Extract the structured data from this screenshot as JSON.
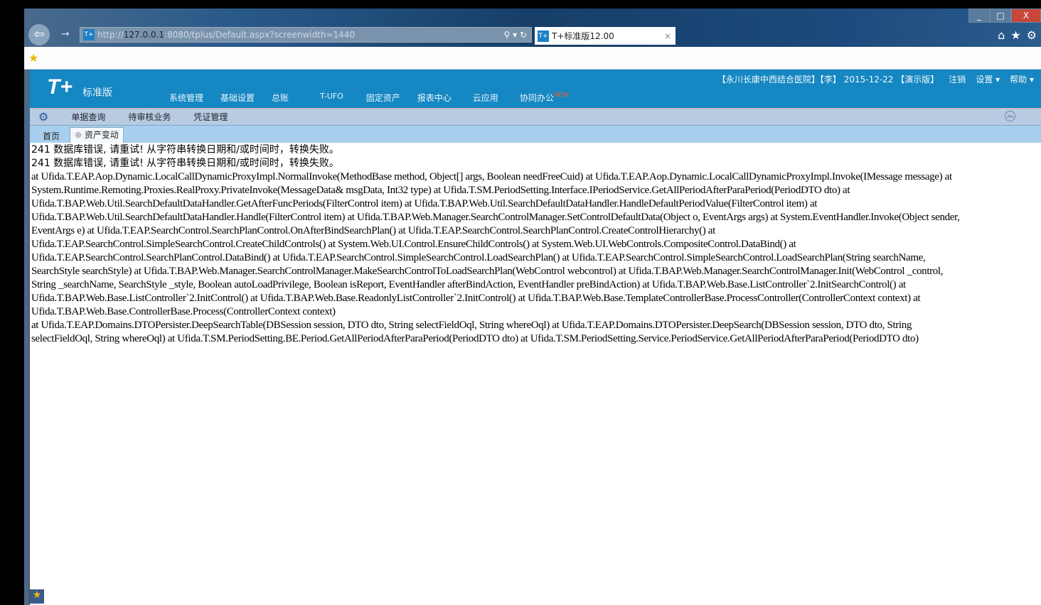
{
  "browser": {
    "url_prefix": "http://",
    "url_host": "127.0.0.1",
    "url_rest": ":8080/tplus/Default.aspx?screenwidth=1440",
    "tab_title": "T+标准版12.00",
    "tab_favicon": "T+",
    "window_buttons": [
      "_",
      "□",
      "X"
    ],
    "tool_icons": [
      "home-icon",
      "star-icon",
      "gear-icon"
    ]
  },
  "app": {
    "logo": "T+",
    "logo_sub": "标准版",
    "nav": [
      "系统管理",
      "基础设置",
      "总账",
      "T-UFO",
      "固定资产",
      "报表中心",
      "云应用",
      "协同办公"
    ],
    "nav_badge": "NEW",
    "user_info": {
      "company": "【永川长康中西结合医院】",
      "user": "【李】",
      "date": "2015-12-22",
      "edition": "【演示版】",
      "logout": "注销",
      "settings": "设置 ▾",
      "help": "帮助 ▾"
    },
    "subnav": [
      "单据查询",
      "待审核业务",
      "凭证管理"
    ],
    "tabs": {
      "home": "首页",
      "active": "资产变动"
    }
  },
  "error": {
    "messages": [
      "241 数据库错误, 请重试! 从字符串转换日期和/或时间时，转换失败。",
      "241 数据库错误, 请重试! 从字符串转换日期和/或时间时，转换失败。"
    ],
    "stack": [
      "at Ufida.T.EAP.Aop.Dynamic.LocalCallDynamicProxyImpl.NormalInvoke(MethodBase method, Object[] args, Boolean needFreeCuid) at Ufida.T.EAP.Aop.Dynamic.LocalCallDynamicProxyImpl.Invoke(IMessage message) at",
      "System.Runtime.Remoting.Proxies.RealProxy.PrivateInvoke(MessageData& msgData, Int32 type) at Ufida.T.SM.PeriodSetting.Interface.IPeriodService.GetAllPeriodAfterParaPeriod(PeriodDTO dto) at",
      "Ufida.T.BAP.Web.Util.SearchDefaultDataHandler.GetAfterFuncPeriods(FilterControl item) at Ufida.T.BAP.Web.Util.SearchDefaultDataHandler.HandleDefaultPeriodValue(FilterControl item) at",
      "Ufida.T.BAP.Web.Util.SearchDefaultDataHandler.Handle(FilterControl item) at Ufida.T.BAP.Web.Manager.SearchControlManager.SetControlDefaultData(Object o, EventArgs args) at System.EventHandler.Invoke(Object sender,",
      "EventArgs e) at Ufida.T.EAP.SearchControl.SearchPlanControl.OnAfterBindSearchPlan() at Ufida.T.EAP.SearchControl.SearchPlanControl.CreateControlHierarchy() at",
      "Ufida.T.EAP.SearchControl.SimpleSearchControl.CreateChildControls() at System.Web.UI.Control.EnsureChildControls() at System.Web.UI.WebControls.CompositeControl.DataBind() at",
      "Ufida.T.EAP.SearchControl.SearchPlanControl.DataBind() at Ufida.T.EAP.SearchControl.SimpleSearchControl.LoadSearchPlan() at Ufida.T.EAP.SearchControl.SimpleSearchControl.LoadSearchPlan(String searchName,",
      "SearchStyle searchStyle) at Ufida.T.BAP.Web.Manager.SearchControlManager.MakeSearchControlToLoadSearchPlan(WebControl webcontrol) at Ufida.T.BAP.Web.Manager.SearchControlManager.Init(WebControl _control,",
      "String _searchName, SearchStyle _style, Boolean autoLoadPrivilege, Boolean isReport, EventHandler afterBindAction, EventHandler preBindAction) at Ufida.T.BAP.Web.Base.ListController`2.InitSearchControl() at",
      "Ufida.T.BAP.Web.Base.ListController`2.InitControl() at Ufida.T.BAP.Web.Base.ReadonlyListController`2.InitControl() at Ufida.T.BAP.Web.Base.TemplateControllerBase.ProcessController(ControllerContext context) at",
      "Ufida.T.BAP.Web.Base.ControllerBase.Process(ControllerContext context)",
      "at Ufida.T.EAP.Domains.DTOPersister.DeepSearchTable(DBSession session, DTO dto, String selectFieldOql, String whereOql) at Ufida.T.EAP.Domains.DTOPersister.DeepSearch(DBSession session, DTO dto, String",
      "selectFieldOql, String whereOql) at Ufida.T.SM.PeriodSetting.BE.Period.GetAllPeriodAfterParaPeriod(PeriodDTO dto) at Ufida.T.SM.PeriodSetting.Service.PeriodService.GetAllPeriodAfterParaPeriod(PeriodDTO dto)"
    ]
  },
  "colors": {
    "header": "#1587c2",
    "subnav": "#b8cbe0",
    "tabstrip": "#a8d0ee"
  }
}
